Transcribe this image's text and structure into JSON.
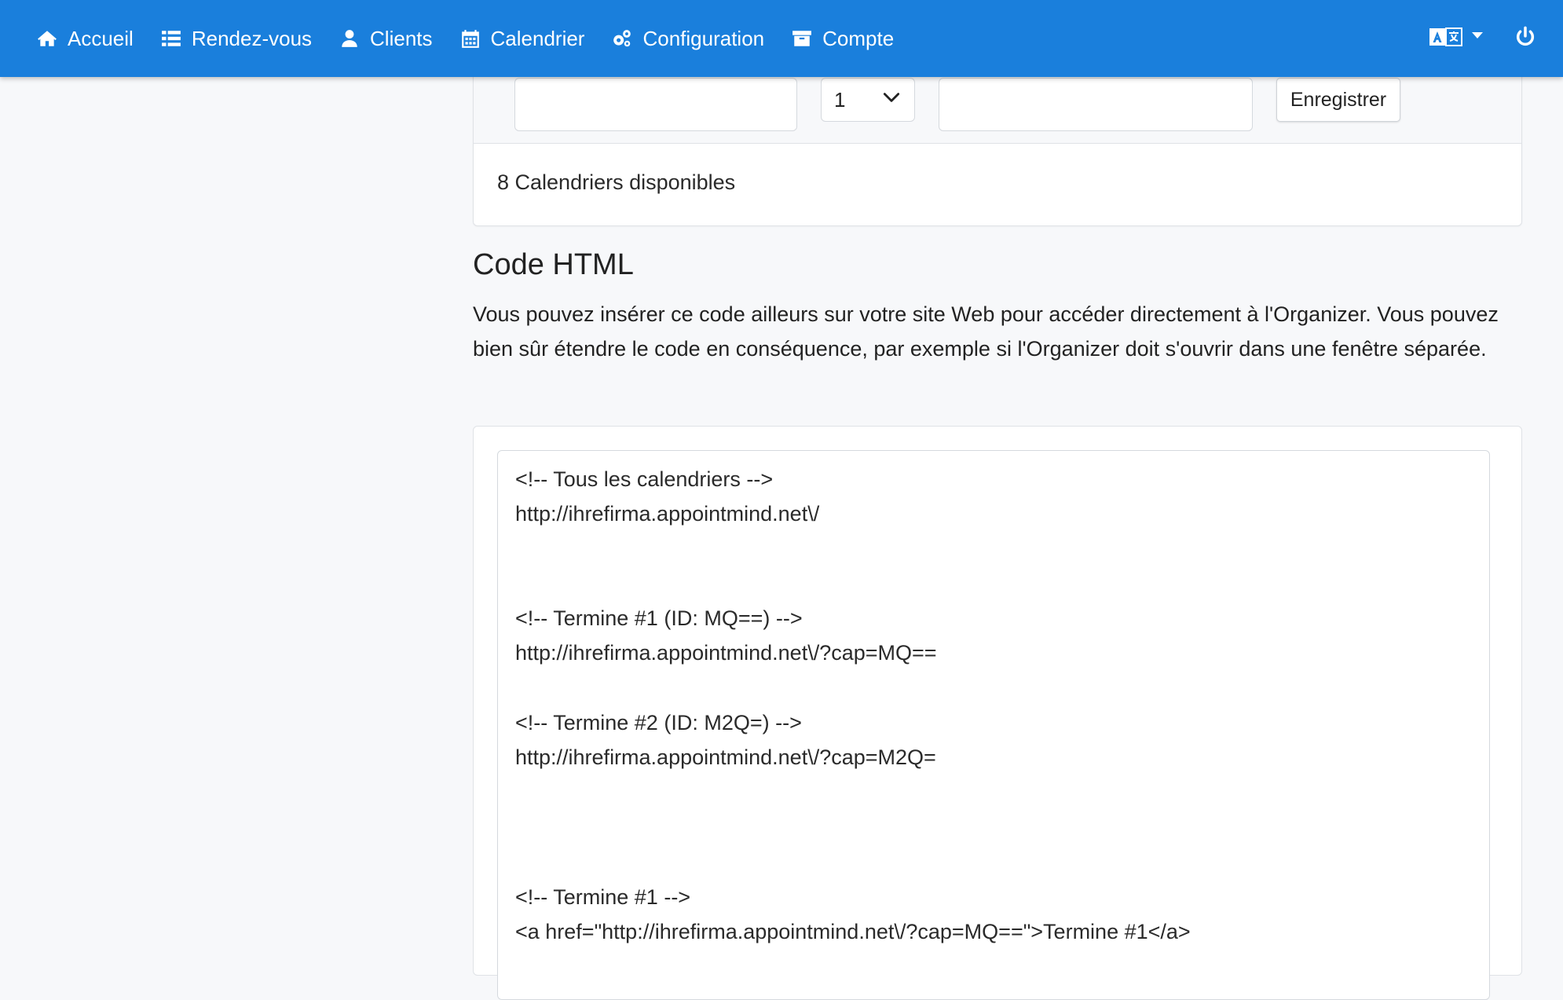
{
  "navbar": {
    "items": [
      {
        "icon": "home-icon",
        "label": "Accueil"
      },
      {
        "icon": "list-icon",
        "label": "Rendez-vous"
      },
      {
        "icon": "user-icon",
        "label": "Clients"
      },
      {
        "icon": "calendar-icon",
        "label": "Calendrier"
      },
      {
        "icon": "cogs-icon",
        "label": "Configuration"
      },
      {
        "icon": "archive-icon",
        "label": "Compte"
      }
    ],
    "language_icon": "translate-icon",
    "power_icon": "power-icon",
    "color": "#1a7fdc"
  },
  "form": {
    "input1_value": "",
    "select_value": "1",
    "input2_value": "",
    "save_label": "Enregistrer"
  },
  "calendars_count": "8 Calendriers disponibles",
  "html_section": {
    "title": "Code HTML",
    "description": "Vous pouvez insérer ce code ailleurs sur votre site Web pour accéder directement à l'Organizer. Vous pouvez bien sûr étendre le code en conséquence, par exemple si l'Organizer doit s'ouvrir dans une fenêtre séparée.",
    "code_lines": [
      "<!-- Tous les calendriers -->",
      "http://ihrefirma.appointmind.net\\/",
      "",
      "",
      "<!-- Termine #1 (ID: MQ==) -->",
      "http://ihrefirma.appointmind.net\\/?cap=MQ==",
      "",
      "<!-- Termine #2 (ID: M2Q=) -->",
      "http://ihrefirma.appointmind.net\\/?cap=M2Q=",
      "",
      "",
      "",
      "<!-- Termine #1 -->",
      "<a href=\"http://ihrefirma.appointmind.net\\/?cap=MQ==\">Termine #1</a>"
    ]
  }
}
